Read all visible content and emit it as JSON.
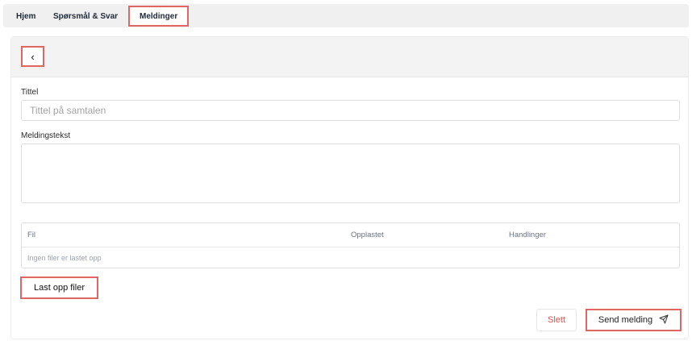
{
  "nav": {
    "tabs": [
      {
        "label": "Hjem"
      },
      {
        "label": "Spørsmål & Svar"
      },
      {
        "label": "Meldinger",
        "active": true
      }
    ]
  },
  "header": {
    "back_label": "‹"
  },
  "form": {
    "title_label": "Tittel",
    "title_placeholder": "Tittel på samtalen",
    "message_label": "Meldingstekst",
    "message_value": ""
  },
  "files": {
    "columns": [
      "Fil",
      "Opplastet",
      "Handlinger"
    ],
    "empty_text": "Ingen filer er lastet opp",
    "upload_label": "Last opp filer"
  },
  "actions": {
    "delete_label": "Slett",
    "send_label": "Send melding",
    "send_icon": "send-icon"
  },
  "colors": {
    "highlight_border": "#e06666",
    "delete_text": "#e05050"
  }
}
